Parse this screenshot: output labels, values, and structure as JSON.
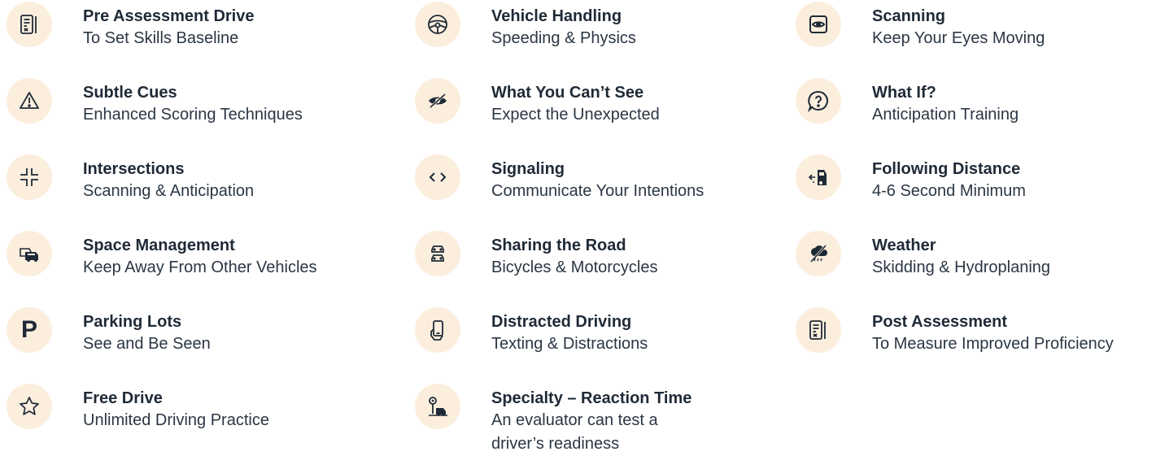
{
  "items": [
    {
      "title": "Pre Assessment Drive",
      "subtitle": "To Set Skills Baseline",
      "icon": "clipboard-icon"
    },
    {
      "title": "Vehicle Handling",
      "subtitle": "Speeding & Physics",
      "icon": "steering-wheel-icon"
    },
    {
      "title": "Scanning",
      "subtitle": "Keep Your Eyes Moving",
      "icon": "eye-frame-icon"
    },
    {
      "title": "Subtle Cues",
      "subtitle": "Enhanced Scoring Techniques",
      "icon": "warning-triangle-icon"
    },
    {
      "title": "What You Can’t See",
      "subtitle": "Expect the Unexpected",
      "icon": "eye-slash-icon"
    },
    {
      "title": "What If?",
      "subtitle": "Anticipation Training",
      "icon": "question-bubble-icon"
    },
    {
      "title": "Intersections",
      "subtitle": "Scanning & Anticipation",
      "icon": "intersection-icon"
    },
    {
      "title": "Signaling",
      "subtitle": "Communicate Your Intentions",
      "icon": "signal-arrows-icon"
    },
    {
      "title": "Following Distance",
      "subtitle": "4-6 Second Minimum",
      "icon": "following-distance-icon"
    },
    {
      "title": "Space Management",
      "subtitle": "Keep Away From Other Vehicles",
      "icon": "cars-icon"
    },
    {
      "title": "Sharing the Road",
      "subtitle": "Bicycles & Motorcycles",
      "icon": "two-cars-icon"
    },
    {
      "title": "Weather",
      "subtitle": "Skidding & Hydroplaning",
      "icon": "weather-icon"
    },
    {
      "title": "Parking Lots",
      "subtitle": "See and Be Seen",
      "icon": "parking-icon",
      "glyph": "P"
    },
    {
      "title": "Distracted Driving",
      "subtitle": "Texting & Distractions",
      "icon": "phone-hand-icon"
    },
    {
      "title": "Post Assessment",
      "subtitle": "To Measure Improved Proficiency",
      "icon": "clipboard-icon"
    },
    {
      "title": "Free Drive",
      "subtitle": "Unlimited Driving Practice",
      "icon": "star-icon"
    },
    {
      "title": "Specialty – Reaction Time",
      "subtitle": "An evaluator can test a driver’s readiness",
      "icon": "reaction-time-icon"
    }
  ],
  "colors": {
    "icon_bg": "#fbeedd",
    "text": "#1f2a37"
  }
}
